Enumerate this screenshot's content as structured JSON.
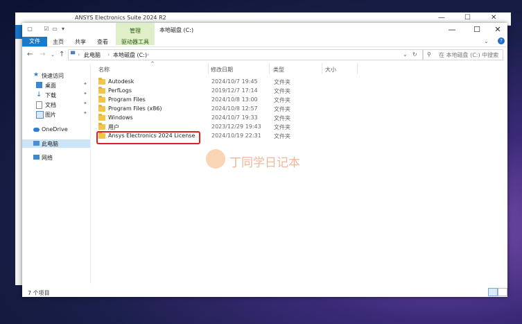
{
  "background_window": {
    "title": "ANSYS Electronics Suite 2024 R2"
  },
  "window": {
    "title": "本地磁盘 (C:)",
    "management_tab": "管理",
    "context_tab": "驱动器工具",
    "tabs": [
      "文件",
      "主页",
      "共享",
      "查看"
    ],
    "help": "?"
  },
  "address": {
    "crumbs": [
      "此电脑",
      "本地磁盘 (C:)"
    ],
    "search_placeholder": "在 本地磁盘 (C:) 中搜索"
  },
  "nav": {
    "quick_access": "快速访问",
    "items": [
      {
        "label": "桌面",
        "pinned": true
      },
      {
        "label": "下载",
        "pinned": true
      },
      {
        "label": "文档",
        "pinned": true
      },
      {
        "label": "图片",
        "pinned": true
      }
    ],
    "onedrive": "OneDrive",
    "this_pc": "此电脑",
    "network": "网络"
  },
  "columns": {
    "name": "名称",
    "date": "修改日期",
    "type": "类型",
    "size": "大小"
  },
  "files": [
    {
      "name": "Autodesk",
      "date": "2024/10/7 19:45",
      "type": "文件夹"
    },
    {
      "name": "PerfLogs",
      "date": "2019/12/7 17:14",
      "type": "文件夹"
    },
    {
      "name": "Program Files",
      "date": "2024/10/8 13:00",
      "type": "文件夹"
    },
    {
      "name": "Program Files (x86)",
      "date": "2024/10/8 12:57",
      "type": "文件夹"
    },
    {
      "name": "Windows",
      "date": "2024/10/7 19:33",
      "type": "文件夹"
    },
    {
      "name": "用户",
      "date": "2023/12/29 19:43",
      "type": "文件夹"
    },
    {
      "name": "Ansys Electronics 2024 License",
      "date": "2024/10/19 22:31",
      "type": "文件夹"
    }
  ],
  "watermark": "丁同学日记本",
  "status": {
    "item_count": "7 个项目"
  },
  "colors": {
    "accent": "#1979ca",
    "highlight_box": "#e02020",
    "folder": "#f1c54a"
  }
}
